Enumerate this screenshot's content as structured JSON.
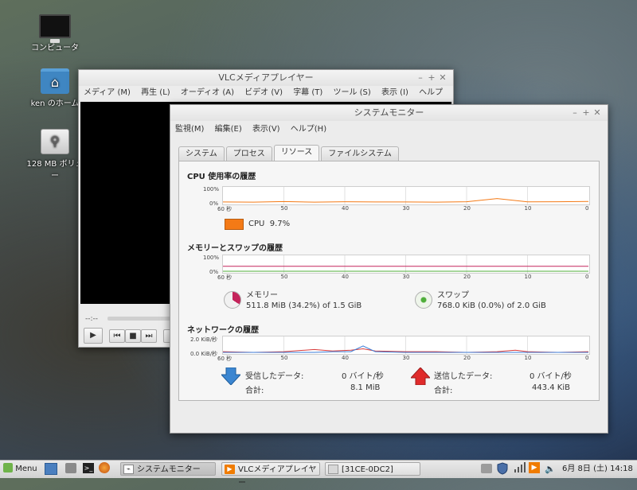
{
  "desktop": {
    "icons": [
      {
        "label": "コンピュータ",
        "icon": "computer-icon"
      },
      {
        "label": "ken のホーム",
        "icon": "home-folder-icon"
      },
      {
        "label": "128 MB ボリュー",
        "icon": "usb-drive-icon"
      }
    ]
  },
  "vlc": {
    "title": "VLCメディアプレイヤー",
    "menus": [
      "メディア (M)",
      "再生 (L)",
      "オーディオ (A)",
      "ビデオ (V)",
      "字幕 (T)",
      "ツール (S)",
      "表示 (I)",
      "ヘルプ (H)"
    ],
    "time": "--:--"
  },
  "sysmon": {
    "title": "システムモニター",
    "menus": [
      "監視(M)",
      "編集(E)",
      "表示(V)",
      "ヘルプ(H)"
    ],
    "tabs": [
      "システム",
      "プロセス",
      "リソース",
      "ファイルシステム"
    ],
    "active_tab": "リソース",
    "cpu": {
      "title": "CPU 使用率の履歴",
      "ytop": "100%",
      "ybottom": "0%",
      "legend_label": "CPU",
      "legend_value": "9.7%",
      "color": "#f47a16"
    },
    "memory": {
      "title": "メモリーとスワップの履歴",
      "ytop": "100%",
      "ybottom": "0%",
      "memory_label": "メモリー",
      "memory_value": "511.8 MiB (34.2%) of 1.5 GiB",
      "memory_color": "#c4245b",
      "swap_label": "スワップ",
      "swap_value": "768.0 KiB (0.0%) of 2.0 GiB",
      "swap_color": "#4fae3a"
    },
    "network": {
      "title": "ネットワークの履歴",
      "ytop": "2.0 KiB/秒",
      "ybottom": "0.0 KiB/秒",
      "recv_label": "受信したデータ:",
      "recv_rate": "0 バイト/秒",
      "recv_total_label": "合計:",
      "recv_total": "8.1 MiB",
      "sent_label": "送信したデータ:",
      "sent_rate": "0 バイト/秒",
      "sent_total_label": "合計:",
      "sent_total": "443.4 KiB",
      "recv_color": "#3b7dd8",
      "sent_color": "#d83b3b"
    },
    "x_ticks": [
      "60 秒",
      "50",
      "40",
      "30",
      "20",
      "10",
      "0"
    ]
  },
  "taskbar": {
    "menu_label": "Menu",
    "windows": [
      "システムモニター",
      "VLCメディアプレイヤー",
      "[31CE-0DC2]"
    ],
    "clock": "6月 8日 (土) 14:18"
  },
  "chart_data": [
    {
      "type": "line",
      "title": "CPU 使用率の履歴",
      "x": [
        60,
        55,
        50,
        45,
        40,
        35,
        30,
        25,
        20,
        15,
        10,
        5,
        0
      ],
      "series": [
        {
          "name": "CPU",
          "values": [
            6,
            5,
            9,
            5,
            8,
            6,
            6,
            5,
            8,
            30,
            7,
            8,
            10
          ]
        }
      ],
      "ylim": [
        0,
        100
      ],
      "xlabel": "",
      "ylabel": ""
    },
    {
      "type": "line",
      "title": "メモリーとスワップの履歴",
      "x": [
        60,
        0
      ],
      "series": [
        {
          "name": "メモリー",
          "values": [
            34.2,
            34.2
          ]
        },
        {
          "name": "スワップ",
          "values": [
            0.0,
            0.0
          ]
        }
      ],
      "ylim": [
        0,
        100
      ],
      "xlabel": "",
      "ylabel": ""
    },
    {
      "type": "line",
      "title": "ネットワークの履歴",
      "x": [
        60,
        55,
        50,
        45,
        42,
        39,
        37,
        35,
        30,
        25,
        20,
        15,
        12,
        10,
        5,
        0
      ],
      "series": [
        {
          "name": "受信したデータ",
          "values": [
            0,
            0,
            0,
            0,
            0.1,
            0.1,
            0.9,
            0.1,
            0,
            0,
            0,
            0,
            0,
            0,
            0,
            0
          ]
        },
        {
          "name": "送信したデータ",
          "values": [
            0.1,
            0,
            0.1,
            0.4,
            0.2,
            0.3,
            0.5,
            0.2,
            0.1,
            0.1,
            0,
            0.1,
            0.3,
            0.1,
            0,
            0.1
          ]
        }
      ],
      "ylim": [
        0,
        2.0
      ],
      "xlabel": "",
      "ylabel": ""
    }
  ]
}
